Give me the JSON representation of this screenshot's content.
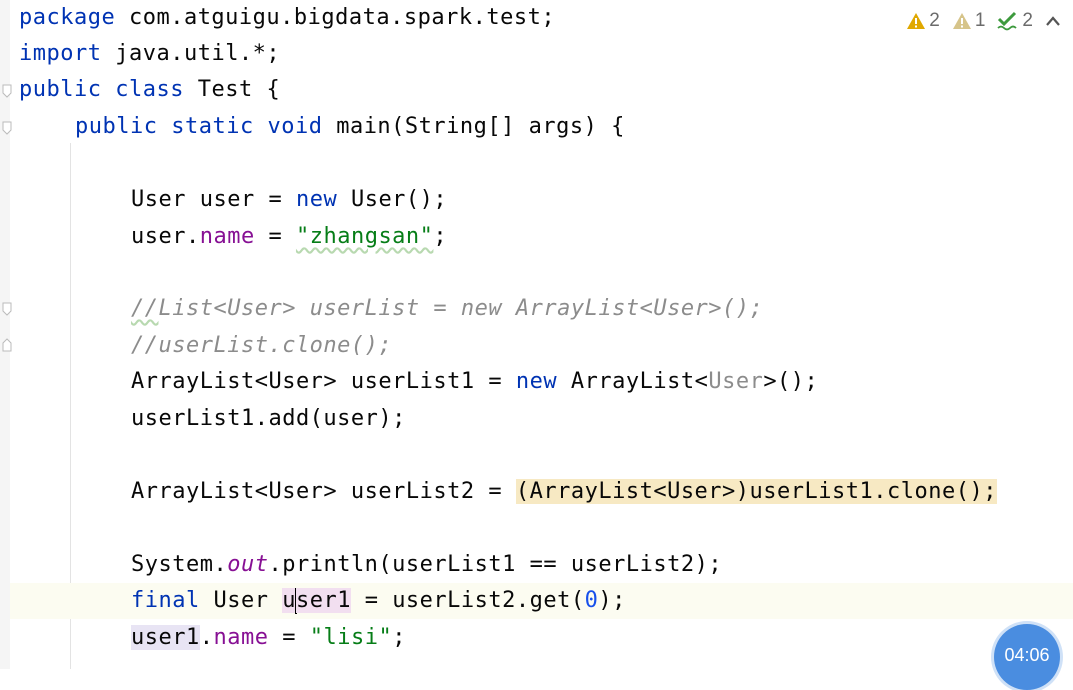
{
  "editor": {
    "lines": {
      "l1": [
        "package",
        " com.atguigu.bigdata.spark.test;"
      ],
      "l2": [
        "import",
        " java.util.*;"
      ],
      "l3": [
        "public",
        " ",
        "class",
        " Test {"
      ],
      "l4": [
        "public",
        " ",
        "static",
        " ",
        "void",
        " main(String[] args) {"
      ],
      "l5": [
        "User user = ",
        "new",
        " User();"
      ],
      "l6": [
        "user.",
        "name",
        " = ",
        "\"zhangsan\"",
        ";"
      ],
      "l7": [
        "//",
        "List<User> userList = new ArrayList<User>();"
      ],
      "l8": [
        "//userList.clone();"
      ],
      "l9": [
        "ArrayList<User> userList1 = ",
        "new",
        " ArrayList<",
        "User",
        ">();"
      ],
      "l10": [
        "userList1.add(user);"
      ],
      "l11": [
        "ArrayList<User> userList2 = ",
        "(ArrayList<User>)userList1.clone()",
        ";"
      ],
      "l12": [
        "System.",
        "out",
        ".println(userList1 == userList2);"
      ],
      "l13": [
        "final",
        " User ",
        "u",
        "ser1",
        " = userList2.get(",
        "0",
        ");"
      ],
      "l14": [
        "user1",
        ".",
        "name",
        " = ",
        "\"lisi\"",
        ";"
      ]
    }
  },
  "inspections": {
    "warnings": "2",
    "weak_warnings": "1",
    "typos": "2",
    "warning_color": "#e0a800",
    "weak_warning_color": "#c9b46a",
    "typo_color": "#3d9a3d"
  },
  "timer": {
    "label": "04:06"
  }
}
